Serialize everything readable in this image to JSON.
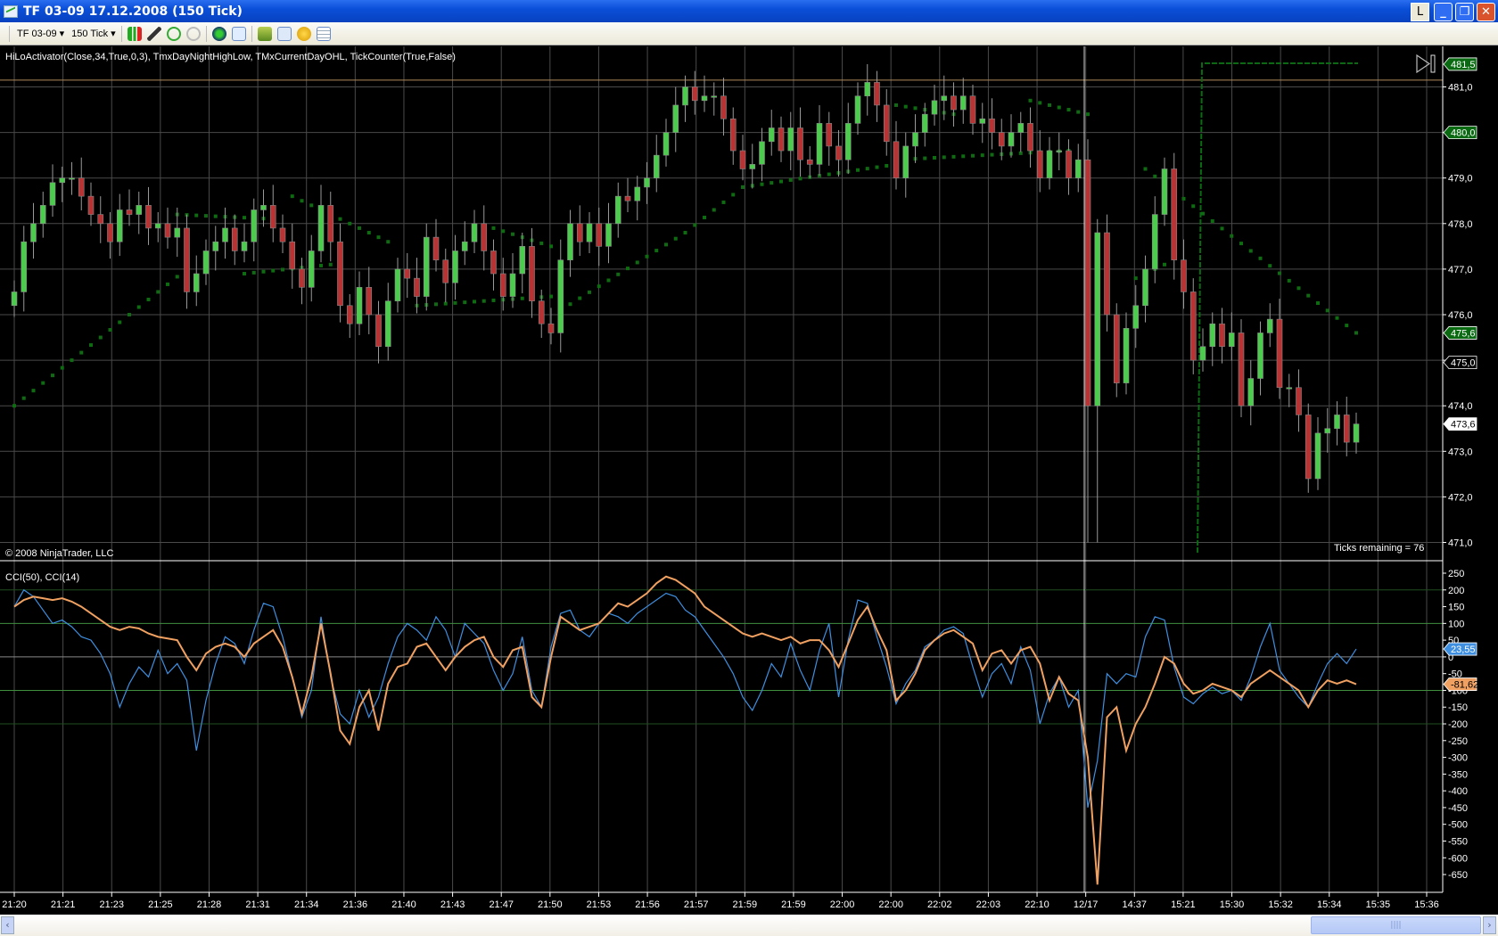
{
  "window": {
    "title": "TF 03-09  17.12.2008 (150 Tick)",
    "btn_l": "L",
    "min": "_",
    "restore": "❐",
    "close": "✕"
  },
  "toolbar": {
    "instrument": "TF 03-09",
    "interval": "150 Tick",
    "dropdown": "▾"
  },
  "chart": {
    "indicators_label": "HiLoActivator(Close,34,True,0,3), TmxDayNightHighLow, TMxCurrentDayOHL, TickCounter(True,False)",
    "copyright": "© 2008 NinjaTrader, LLC",
    "ticks_remaining": "Ticks remaining = 76",
    "cci_label": "CCI(50), CCI(14)"
  },
  "colors": {
    "up": "#4ccc4c",
    "down": "#b83434",
    "hilo": "#0f6b12",
    "cci50": "#f0a060",
    "cci14": "#3f8fe0",
    "grid": "#4a4a4a",
    "green_marker": "#0a6a12"
  },
  "chart_data": [
    {
      "type": "candlestick",
      "title": "TF 03-09 150 Tick",
      "ylim": [
        470.8,
        481.8
      ],
      "yticks": [
        "481,0",
        "480,0",
        "479,0",
        "478,0",
        "477,0",
        "476,0",
        "475,0",
        "474,0",
        "473,0",
        "472,0",
        "471,0"
      ],
      "ytick_values": [
        481,
        480,
        479,
        478,
        477,
        476,
        475,
        474,
        473,
        472,
        471
      ],
      "xticks": [
        "21:20",
        "21:21",
        "21:23",
        "21:25",
        "21:28",
        "21:31",
        "21:34",
        "21:36",
        "21:40",
        "21:43",
        "21:47",
        "21:50",
        "21:53",
        "21:56",
        "21:57",
        "21:59",
        "21:59",
        "22:00",
        "22:00",
        "22:02",
        "22:03",
        "22:10",
        "12/17",
        "14:37",
        "15:21",
        "15:30",
        "15:32",
        "15:34",
        "15:35",
        "15:36"
      ],
      "first_open": 476.2,
      "closes": [
        476.5,
        477.6,
        478.0,
        478.4,
        478.9,
        479.0,
        479.0,
        478.6,
        478.2,
        478.0,
        477.6,
        478.3,
        478.2,
        478.4,
        477.9,
        478.0,
        477.7,
        477.9,
        476.5,
        476.9,
        477.4,
        477.6,
        477.9,
        477.4,
        477.6,
        478.3,
        478.4,
        477.9,
        477.6,
        477.0,
        476.6,
        477.4,
        478.4,
        477.6,
        476.2,
        475.8,
        476.6,
        476.0,
        475.3,
        476.3,
        477.0,
        476.8,
        476.4,
        477.7,
        477.2,
        476.7,
        477.4,
        477.6,
        478.0,
        477.4,
        476.9,
        476.4,
        476.9,
        477.5,
        476.3,
        475.8,
        475.6,
        477.2,
        478.0,
        477.6,
        478.0,
        477.5,
        478.0,
        478.6,
        478.5,
        478.8,
        479.0,
        479.5,
        480.0,
        480.6,
        481.0,
        480.7,
        480.8,
        480.8,
        480.3,
        479.6,
        479.2,
        479.3,
        479.8,
        480.1,
        479.6,
        480.1,
        479.4,
        479.3,
        480.2,
        479.7,
        479.4,
        480.2,
        480.8,
        481.1,
        480.6,
        479.8,
        479.0,
        479.7,
        480.0,
        480.4,
        480.7,
        480.8,
        480.5,
        480.8,
        480.2,
        480.3,
        480.0,
        479.7,
        480.0,
        480.2,
        479.6,
        479.0,
        479.6,
        479.6,
        479.0,
        479.4,
        474.0,
        477.8,
        476.0,
        474.5,
        475.7,
        476.2,
        477.0,
        478.2,
        479.2,
        477.2,
        476.5,
        475.0,
        475.3,
        475.8,
        475.3,
        475.6,
        474.0,
        474.6,
        475.6,
        475.9,
        474.4,
        474.4,
        473.8,
        472.4,
        473.4,
        473.5,
        473.8,
        473.2,
        473.6
      ],
      "special_lows": {
        "112": 471.0,
        "113": 471.0
      },
      "hilo_segments": [
        [
          0,
          18,
          474.0,
          477.0
        ],
        [
          17,
          27,
          478.2,
          478.1
        ],
        [
          24,
          33,
          476.9,
          477.1
        ],
        [
          29,
          39,
          478.6,
          477.6
        ],
        [
          42,
          56,
          476.2,
          476.4
        ],
        [
          50,
          56,
          477.9,
          477.5
        ],
        [
          57,
          70,
          476.1,
          477.8
        ],
        [
          70,
          76,
          477.8,
          478.8
        ],
        [
          76,
          92,
          478.8,
          479.3
        ],
        [
          92,
          110,
          479.4,
          479.6
        ],
        [
          92,
          98,
          480.6,
          480.4
        ],
        [
          106,
          112,
          480.7,
          480.4
        ],
        [
          118,
          140,
          479.2,
          475.6
        ],
        [
          117,
          120,
          476.8,
          477.1
        ]
      ],
      "day_high": 481.15,
      "price_markers": [
        {
          "label": "481,5",
          "value": 481.5,
          "style": "green"
        },
        {
          "label": "480,0",
          "value": 480.0,
          "style": "green"
        },
        {
          "label": "475,6",
          "value": 475.6,
          "style": "green"
        },
        {
          "label": "475,0",
          "value": 474.95,
          "style": "outline"
        },
        {
          "label": "473,6",
          "value": 473.6,
          "style": "white"
        }
      ]
    },
    {
      "type": "line",
      "title": "CCI(50), CCI(14)",
      "ylim": [
        -690,
        270
      ],
      "yticks": [
        "250",
        "200",
        "150",
        "100",
        "50",
        "0",
        "-50",
        "-100",
        "-150",
        "-200",
        "-250",
        "-300",
        "-350",
        "-400",
        "-450",
        "-500",
        "-550",
        "-600",
        "-650"
      ],
      "ytick_values": [
        250,
        200,
        150,
        100,
        50,
        0,
        -50,
        -100,
        -150,
        -200,
        -250,
        -300,
        -350,
        -400,
        -450,
        -500,
        -550,
        -600,
        -650
      ],
      "levels": [
        200,
        100,
        0,
        -100,
        -200
      ],
      "series": [
        {
          "name": "CCI(50)",
          "last_label": "-81,62",
          "values": [
            150,
            170,
            180,
            175,
            170,
            175,
            165,
            150,
            130,
            110,
            90,
            80,
            90,
            85,
            70,
            60,
            55,
            50,
            0,
            -40,
            10,
            30,
            40,
            30,
            0,
            40,
            60,
            80,
            30,
            -60,
            -170,
            -60,
            100,
            -50,
            -220,
            -260,
            -150,
            -100,
            -220,
            -80,
            -30,
            -20,
            30,
            40,
            0,
            -40,
            0,
            30,
            50,
            60,
            0,
            -30,
            20,
            30,
            -120,
            -150,
            0,
            120,
            100,
            80,
            90,
            100,
            130,
            160,
            150,
            170,
            190,
            220,
            240,
            230,
            210,
            190,
            150,
            130,
            110,
            90,
            70,
            60,
            70,
            60,
            50,
            60,
            40,
            50,
            50,
            20,
            -30,
            40,
            110,
            150,
            80,
            20,
            -130,
            -100,
            -50,
            20,
            50,
            70,
            80,
            60,
            40,
            -40,
            10,
            20,
            -20,
            20,
            30,
            -20,
            -130,
            -60,
            -110,
            -130,
            -300,
            -680,
            -180,
            -150,
            -280,
            -200,
            -150,
            -80,
            0,
            -20,
            -80,
            -110,
            -100,
            -80,
            -90,
            -100,
            -120,
            -80,
            -60,
            -40,
            -60,
            -80,
            -100,
            -150,
            -100,
            -70,
            -80,
            -70,
            -81.62
          ]
        },
        {
          "name": "CCI(14)",
          "last_label": "23,55",
          "values": [
            150,
            200,
            180,
            140,
            100,
            110,
            90,
            60,
            50,
            10,
            -50,
            -150,
            -80,
            -30,
            -60,
            20,
            -50,
            -20,
            -70,
            -280,
            -130,
            -20,
            60,
            40,
            -20,
            80,
            160,
            150,
            60,
            -60,
            -180,
            -100,
            120,
            -60,
            -170,
            -200,
            -100,
            -180,
            -120,
            -20,
            60,
            100,
            80,
            50,
            120,
            80,
            0,
            100,
            70,
            40,
            -40,
            -100,
            -50,
            60,
            -100,
            -150,
            30,
            130,
            140,
            80,
            60,
            100,
            130,
            120,
            100,
            130,
            150,
            170,
            190,
            180,
            140,
            120,
            80,
            40,
            0,
            -50,
            -120,
            -160,
            -100,
            -20,
            -60,
            40,
            -40,
            -100,
            20,
            100,
            -120,
            50,
            170,
            160,
            60,
            -30,
            -140,
            -80,
            -40,
            30,
            50,
            80,
            90,
            70,
            -30,
            -120,
            -50,
            -20,
            -80,
            30,
            -40,
            -200,
            -110,
            -60,
            -150,
            -100,
            -450,
            -310,
            -50,
            -80,
            -50,
            -60,
            60,
            120,
            110,
            -30,
            -120,
            -140,
            -110,
            -90,
            -110,
            -100,
            -130,
            -60,
            30,
            100,
            -40,
            -80,
            -120,
            -150,
            -80,
            -20,
            10,
            -20,
            23.55
          ]
        }
      ]
    }
  ]
}
